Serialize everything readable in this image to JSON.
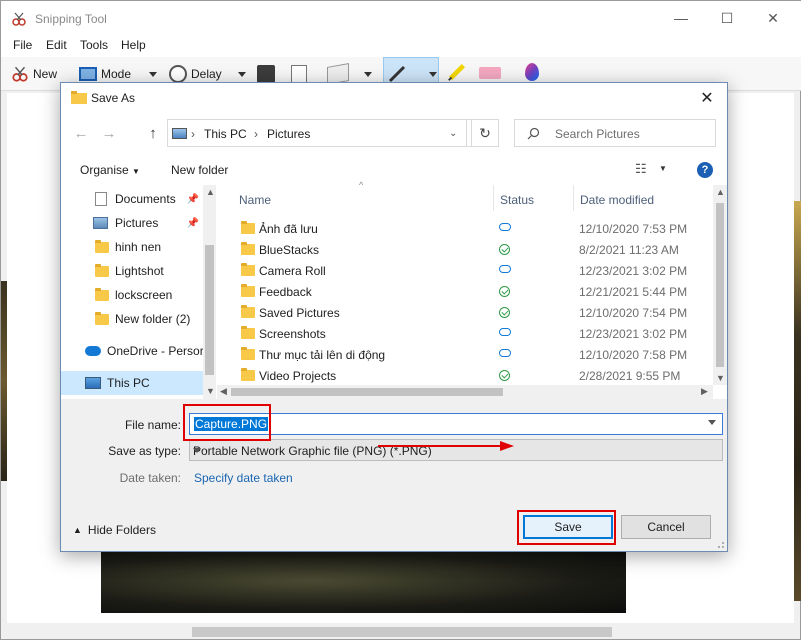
{
  "snipping_tool": {
    "title": "Snipping Tool",
    "menu": [
      "File",
      "Edit",
      "Tools",
      "Help"
    ],
    "toolbar": {
      "new_label": "New",
      "mode_label": "Mode",
      "delay_label": "Delay"
    }
  },
  "dialog": {
    "title": "Save As",
    "breadcrumb": [
      "This PC",
      "Pictures"
    ],
    "search_placeholder": "Search Pictures",
    "organise_label": "Organise",
    "new_folder_label": "New folder",
    "help_glyph": "?",
    "nav_items": [
      {
        "label": "Documents",
        "icon": "documents-icon",
        "pinned": true
      },
      {
        "label": "Pictures",
        "icon": "pictures-icon",
        "pinned": true
      },
      {
        "label": "hinh nen",
        "icon": "folder-icon"
      },
      {
        "label": "Lightshot",
        "icon": "folder-icon"
      },
      {
        "label": "lockscreen",
        "icon": "folder-icon"
      },
      {
        "label": "New folder (2)",
        "icon": "folder-icon"
      },
      {
        "label": "OneDrive - Persor",
        "icon": "onedrive-icon"
      },
      {
        "label": "This PC",
        "icon": "this-pc-icon",
        "selected": true
      }
    ],
    "columns": {
      "name": "Name",
      "status": "Status",
      "date": "Date modified"
    },
    "files": [
      {
        "name": "Ảnh đã lưu",
        "status": "cloud",
        "date": "12/10/2020 7:53 PM"
      },
      {
        "name": "BlueStacks",
        "status": "synced",
        "date": "8/2/2021 11:23 AM"
      },
      {
        "name": "Camera Roll",
        "status": "cloud",
        "date": "12/23/2021 3:02 PM"
      },
      {
        "name": "Feedback",
        "status": "synced",
        "date": "12/21/2021 5:44 PM"
      },
      {
        "name": "Saved Pictures",
        "status": "synced",
        "date": "12/10/2020 7:54 PM"
      },
      {
        "name": "Screenshots",
        "status": "cloud",
        "date": "12/23/2021 3:02 PM"
      },
      {
        "name": "Thư mục tải lên di động",
        "status": "cloud",
        "date": "12/10/2020 7:58 PM"
      },
      {
        "name": "Video Projects",
        "status": "synced",
        "date": "2/28/2021 9:55 PM"
      }
    ],
    "file_name_label": "File name:",
    "file_name_value": "Capture.PNG",
    "save_as_type_label": "Save as type:",
    "save_as_type_value": "Portable Network Graphic file (PNG) (*.PNG)",
    "date_taken_label": "Date taken:",
    "date_taken_value": "Specify date taken",
    "hide_folders_label": "Hide Folders",
    "save_label": "Save",
    "cancel_label": "Cancel"
  },
  "colors": {
    "accent": "#0078d7",
    "annotation_red": "#e00000",
    "link": "#1a66b3",
    "folder": "#f8c948"
  }
}
